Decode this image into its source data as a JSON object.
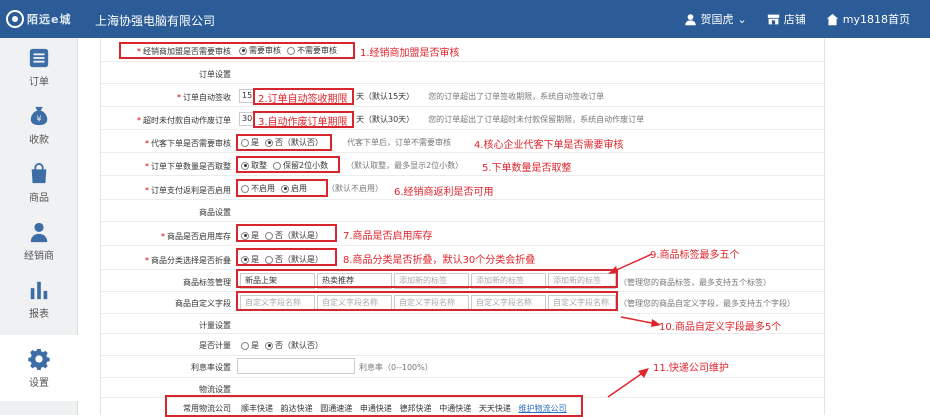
{
  "topbar": {
    "logo_text": "陌远e城",
    "company": "上海协强电脑有限公司",
    "user": "贺国虎",
    "user_arrow": "⌄",
    "store": "店铺",
    "home": "my1818首页"
  },
  "sidebar": [
    {
      "label": "订单",
      "icon": "list-icon"
    },
    {
      "label": "收款",
      "icon": "money-bag-icon"
    },
    {
      "label": "商品",
      "icon": "shopping-bag-icon"
    },
    {
      "label": "经销商",
      "icon": "person-icon"
    },
    {
      "label": "报表",
      "icon": "bar-chart-icon"
    },
    {
      "label": "设置",
      "icon": "gear-icon"
    }
  ],
  "rows": {
    "dealer_audit": {
      "label": "经销商加盟是否需要审核",
      "opt1": "需要审核",
      "opt2": "不需要审核",
      "note": "1.经销商加盟是否审核"
    },
    "order_section": "订单设置",
    "auto_sign": {
      "label": "订单自动签收",
      "value": "15",
      "unit": "天（默认15天）",
      "hint": "您的订单超出了订单签收期限，系统自动签收订单",
      "note": "2.订单自动签收期限"
    },
    "auto_void": {
      "label": "超时未付款自动作废订单",
      "value": "30",
      "unit": "天（默认30天）",
      "hint": "您的订单超出了订单超时未付款保留期限，系统自动作废订单",
      "note": "3.自动作废订单期限"
    },
    "proxy_order": {
      "label": "代客下单是否需要审核",
      "opt1": "是",
      "opt2": "否（默认否）",
      "hint": "代客下单后，订单不需要审核",
      "note": "4.核心企业代客下单是否需要审核"
    },
    "quantity": {
      "label": "订单下单数量是否取整",
      "opt1": "取整",
      "opt2": "保留2位小数",
      "hint": "（默认取整，最多显示2位小数）",
      "note": "5.下单数量是否取整"
    },
    "rebate": {
      "label": "订单支付返利是否启用",
      "opt1": "不启用",
      "opt2": "启用",
      "hint": "（默认不启用）",
      "note": "6.经销商返利是否可用"
    },
    "goods_section": "商品设置",
    "stock": {
      "label": "商品是否启用库存",
      "opt1": "是",
      "opt2": "否（默认是）",
      "note": "7.商品是否启用库存"
    },
    "fold": {
      "label": "商品分类选择是否折叠",
      "opt1": "是",
      "opt2": "否（默认是）",
      "note": "8.商品分类是否折叠，默认30个分类会折叠"
    },
    "tags": {
      "label": "商品标签管理",
      "items": [
        "新品上架",
        "热卖推荐"
      ],
      "placeholders": [
        "添加新的标签",
        "添加新的标签",
        "添加新的标签"
      ],
      "hint": "（管理您的商品标签，最多支持五个标签）",
      "note": "9.商品标签最多五个"
    },
    "custom_fields": {
      "label": "商品自定义字段",
      "placeholders": [
        "自定义字段名称",
        "自定义字段名称",
        "自定义字段名称",
        "自定义字段名称",
        "自定义字段名称"
      ],
      "hint": "（管理您的商品自定义字段，最多支持五个字段）",
      "note": "10.商品自定义字段最多5个"
    },
    "measure_section": "计量设置",
    "measure": {
      "label": "是否计量",
      "opt1": "是",
      "opt2": "否（默认否）"
    },
    "profit": {
      "label": "利息率设置",
      "hint": "利息率（0--100%）"
    },
    "logistics_section": "物流设置",
    "logistics": {
      "label": "常用物流公司",
      "companies": [
        "顺丰快递",
        "韵达快递",
        "圆通速递",
        "申通快递",
        "德邦快递",
        "中通快递",
        "天天快递"
      ],
      "link": "维护物流公司",
      "note": "11.快递公司维护"
    }
  }
}
